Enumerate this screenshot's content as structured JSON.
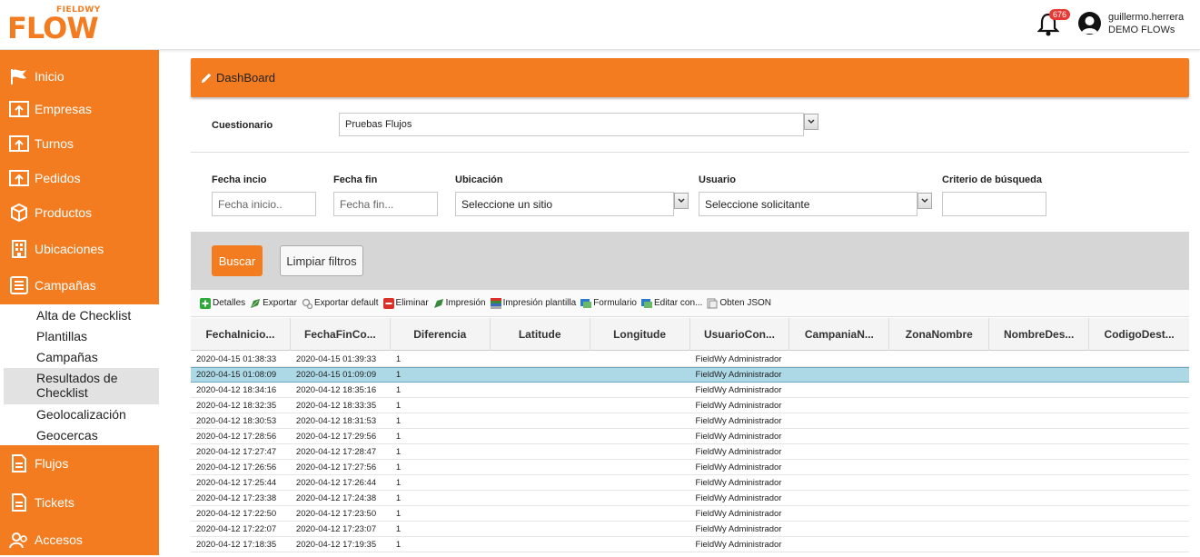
{
  "header": {
    "logo_small": "FIELDWY",
    "logo_big": "FLOW",
    "notification_count": "676",
    "username": "guillermo.herrera",
    "company": "DEMO FLOWs"
  },
  "sidebar": {
    "items": [
      {
        "label": "Inicio",
        "icon": "flag-icon"
      },
      {
        "label": "Empresas",
        "icon": "screen-upload-icon"
      },
      {
        "label": "Turnos",
        "icon": "screen-upload-icon"
      },
      {
        "label": "Pedidos",
        "icon": "screen-upload-icon"
      },
      {
        "label": "Productos",
        "icon": "cube-icon"
      },
      {
        "label": "Ubicaciones",
        "icon": "building-icon"
      },
      {
        "label": "Campañas",
        "icon": "list-doc-icon"
      }
    ],
    "subitems": [
      {
        "label": "Alta de Checklist"
      },
      {
        "label": "Plantillas"
      },
      {
        "label": "Campañas"
      },
      {
        "label": "Resultados de Checklist",
        "active": true
      },
      {
        "label": "Geolocalización"
      },
      {
        "label": "Geocercas"
      }
    ],
    "items_bottom": [
      {
        "label": "Flujos",
        "icon": "document-icon"
      },
      {
        "label": "Tickets",
        "icon": "document-icon"
      },
      {
        "label": "Accesos",
        "icon": "users-icon"
      }
    ]
  },
  "panel": {
    "title": "DashBoard"
  },
  "form": {
    "cuestionario_label": "Cuestionario",
    "cuestionario_value": "Pruebas Flujos",
    "fecha_inicio_label": "Fecha incio",
    "fecha_inicio_placeholder": "Fecha inicio..",
    "fecha_fin_label": "Fecha fin",
    "fecha_fin_placeholder": "Fecha fin...",
    "ubicacion_label": "Ubicación",
    "ubicacion_value": "Seleccione un sitio",
    "usuario_label": "Usuario",
    "usuario_value": "Seleccione solicitante",
    "criterio_label": "Criterio de búsqueda",
    "criterio_value": ""
  },
  "actions": {
    "buscar": "Buscar",
    "limpiar": "Limpiar filtros"
  },
  "toolbar": [
    {
      "label": "Detalles",
      "icon": "plus-icon",
      "color": "#2eaa3a"
    },
    {
      "label": "Exportar",
      "icon": "export-icon",
      "color": "#3a8a3a"
    },
    {
      "label": "Exportar default",
      "icon": "gears-icon",
      "color": "#999999"
    },
    {
      "label": "Eliminar",
      "icon": "delete-icon",
      "color": "#d9302a"
    },
    {
      "label": "Impresión",
      "icon": "print-icon",
      "color": "#3a8a3a"
    },
    {
      "label": "Impresión plantilla",
      "icon": "template-icon",
      "color": "#3a6ac0"
    },
    {
      "label": "Formulario",
      "icon": "form-icon",
      "color": "#2a7ad0"
    },
    {
      "label": "Editar con...",
      "icon": "edit-icon",
      "color": "#2a7ad0"
    },
    {
      "label": "Obten JSON",
      "icon": "json-icon",
      "color": "#888888"
    }
  ],
  "table": {
    "columns": [
      "FechaInicio...",
      "FechaFinCo...",
      "Diferencia",
      "Latitude",
      "Longitude",
      "UsuarioCon...",
      "CampaniaN...",
      "ZonaNombre",
      "NombreDes...",
      "CodigoDest..."
    ],
    "rows": [
      [
        "2020-04-15 01:38:33",
        "2020-04-15 01:39:33",
        "1",
        "",
        "",
        "FieldWy Administrador",
        "",
        "",
        "",
        ""
      ],
      [
        "2020-04-15 01:08:09",
        "2020-04-15 01:09:09",
        "1",
        "",
        "",
        "FieldWy Administrador",
        "",
        "",
        "",
        ""
      ],
      [
        "2020-04-12 18:34:16",
        "2020-04-12 18:35:16",
        "1",
        "",
        "",
        "FieldWy Administrador",
        "",
        "",
        "",
        ""
      ],
      [
        "2020-04-12 18:32:35",
        "2020-04-12 18:33:35",
        "1",
        "",
        "",
        "FieldWy Administrador",
        "",
        "",
        "",
        ""
      ],
      [
        "2020-04-12 18:30:53",
        "2020-04-12 18:31:53",
        "1",
        "",
        "",
        "FieldWy Administrador",
        "",
        "",
        "",
        ""
      ],
      [
        "2020-04-12 17:28:56",
        "2020-04-12 17:29:56",
        "1",
        "",
        "",
        "FieldWy Administrador",
        "",
        "",
        "",
        ""
      ],
      [
        "2020-04-12 17:27:47",
        "2020-04-12 17:28:47",
        "1",
        "",
        "",
        "FieldWy Administrador",
        "",
        "",
        "",
        ""
      ],
      [
        "2020-04-12 17:26:56",
        "2020-04-12 17:27:56",
        "1",
        "",
        "",
        "FieldWy Administrador",
        "",
        "",
        "",
        ""
      ],
      [
        "2020-04-12 17:25:44",
        "2020-04-12 17:26:44",
        "1",
        "",
        "",
        "FieldWy Administrador",
        "",
        "",
        "",
        ""
      ],
      [
        "2020-04-12 17:23:38",
        "2020-04-12 17:24:38",
        "1",
        "",
        "",
        "FieldWy Administrador",
        "",
        "",
        "",
        ""
      ],
      [
        "2020-04-12 17:22:50",
        "2020-04-12 17:23:50",
        "1",
        "",
        "",
        "FieldWy Administrador",
        "",
        "",
        "",
        ""
      ],
      [
        "2020-04-12 17:22:07",
        "2020-04-12 17:23:07",
        "1",
        "",
        "",
        "FieldWy Administrador",
        "",
        "",
        "",
        ""
      ],
      [
        "2020-04-12 17:18:35",
        "2020-04-12 17:19:35",
        "1",
        "",
        "",
        "FieldWy Administrador",
        "",
        "",
        "",
        ""
      ]
    ],
    "selected_row": 1,
    "selected_color": "#add9e6"
  },
  "colors": {
    "accent": "#f47c20"
  }
}
